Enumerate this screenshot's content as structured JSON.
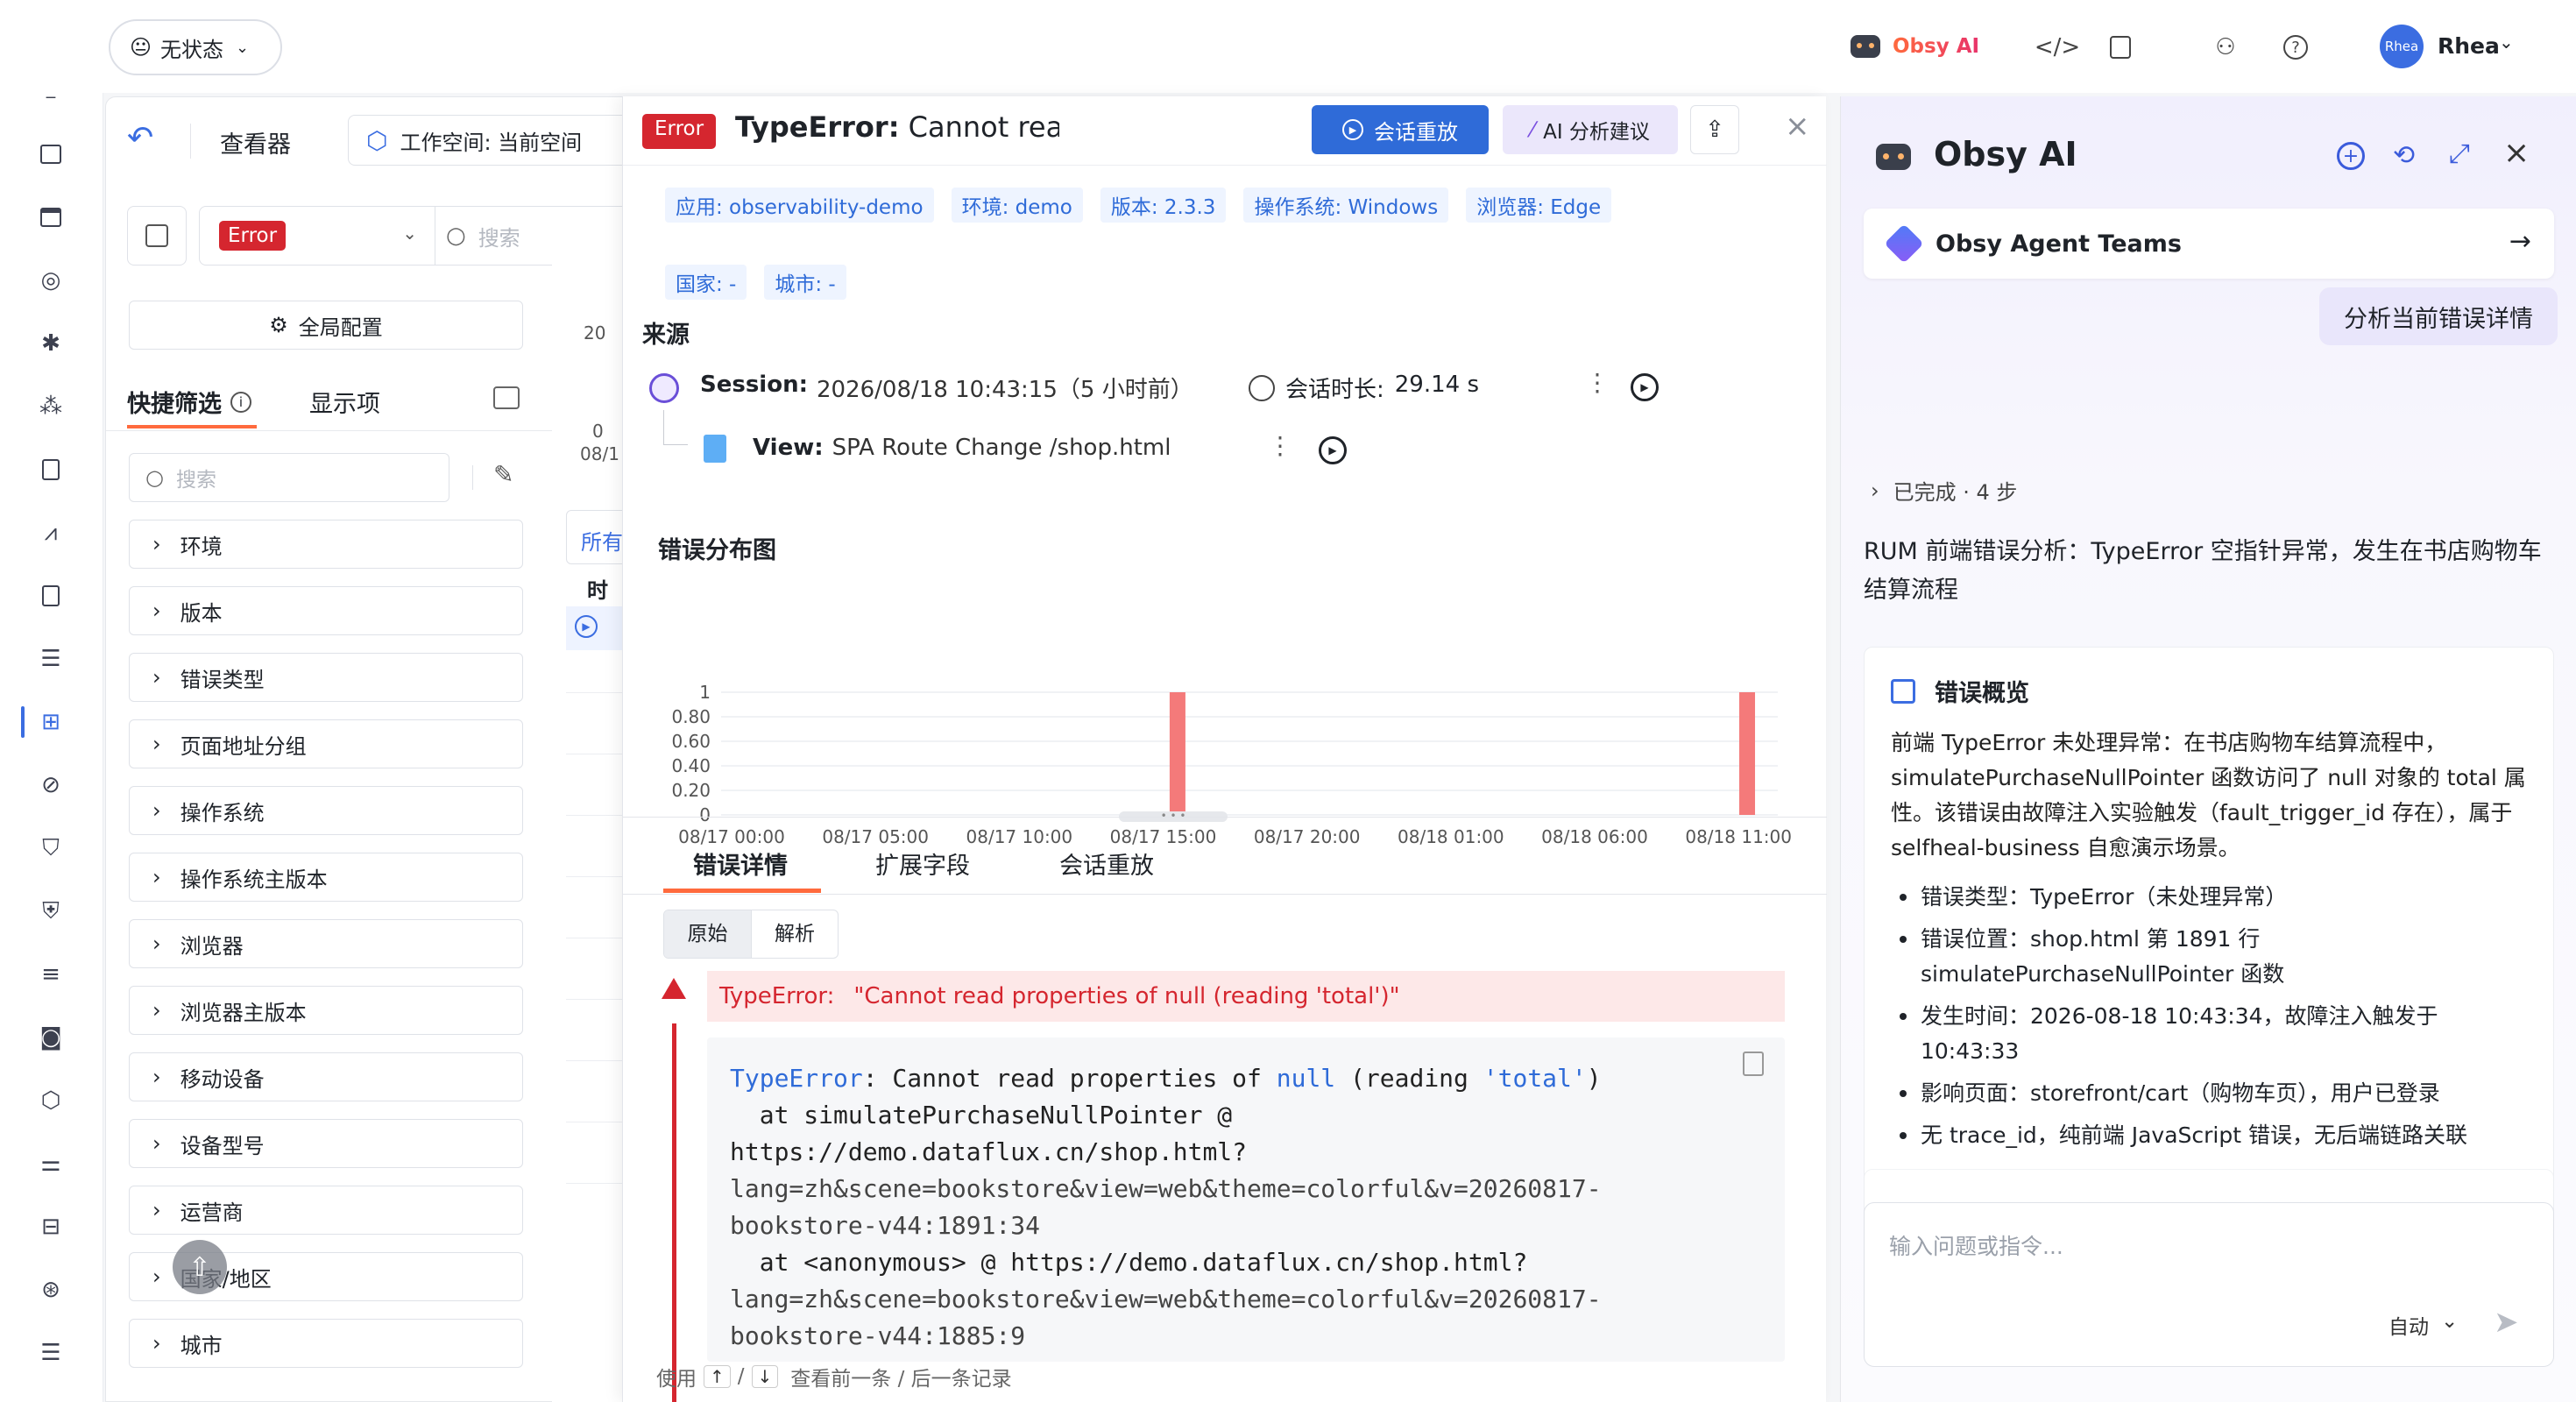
{
  "topbar": {
    "status_label": "无状态",
    "status_emoji": "😐",
    "ai_label": "Obsy AI",
    "user_name": "Rhea",
    "avatar_text": "Rhea"
  },
  "filter_panel": {
    "back_icon": "undo-icon",
    "viewer_label": "查看器",
    "workspace_label": "工作空间: 当前空间",
    "error_filter_value": "Error",
    "search_placeholder": "搜索",
    "global_config_label": "全局配置",
    "tab_quick_filter": "快捷筛选",
    "tab_display": "显示项",
    "facet_search_placeholder": "搜索",
    "facets": [
      "环境",
      "版本",
      "错误类型",
      "页面地址分组",
      "操作系统",
      "操作系统主版本",
      "浏览器",
      "浏览器主版本",
      "移动设备",
      "设备型号",
      "运营商",
      "国家/地区",
      "城市"
    ]
  },
  "mid_strip": {
    "y_top": "20",
    "y_zero": "0",
    "x_label": "08/1",
    "tab_all": "所有",
    "col_time": "时间"
  },
  "drawer": {
    "level_badge": "Error",
    "title_prefix": "TypeError:",
    "title_message": "Cannot read properties of null...",
    "replay_button": "会话重放",
    "ai_button": "AI 分析建议",
    "tags_row1": [
      "应用: observability-demo",
      "环境: demo",
      "版本: 2.3.3",
      "操作系统: Windows",
      "浏览器: Edge"
    ],
    "tags_row2": [
      "国家: -",
      "城市: -"
    ],
    "source_heading": "来源",
    "session_label": "Session:",
    "session_time": "2026/08/18 10:43:15（5 小时前）",
    "duration_label": "会话时长:",
    "duration_value": "29.14 s",
    "view_label": "View:",
    "view_value": "SPA Route Change /shop.html",
    "chart_title": "错误分布图",
    "tabs": [
      "错误详情",
      "扩展字段",
      "会话重放"
    ],
    "subtabs": [
      "原始",
      "解析"
    ],
    "error_banner_type": "TypeError:",
    "error_banner_msg": "\"Cannot read properties of null (reading 'total')\"",
    "stack_lines": [
      "TypeError: Cannot read properties of null (reading 'total')",
      "  at simulatePurchaseNullPointer @",
      "https://demo.dataflux.cn/shop.html?",
      "lang=zh&scene=bookstore&view=web&theme=colorful&v=20260817-",
      "bookstore-v44:1891:34",
      "  at <anonymous> @ https://demo.dataflux.cn/shop.html?",
      "lang=zh&scene=bookstore&view=web&theme=colorful&v=20260817-",
      "bookstore-v44:1885:9"
    ],
    "footer_use": "使用",
    "footer_up": "↑",
    "footer_sep": "/",
    "footer_down": "↓",
    "footer_text": "查看前一条 / 后一条记录"
  },
  "chart_data": {
    "type": "bar",
    "title": "错误分布图",
    "x_ticks": [
      "08/17 00:00",
      "08/17 05:00",
      "08/17 10:00",
      "08/17 15:00",
      "08/17 20:00",
      "08/18 01:00",
      "08/18 06:00",
      "08/18 11:00"
    ],
    "y_ticks": [
      "1",
      "0.80",
      "0.60",
      "0.40",
      "0.20",
      "0"
    ],
    "ylim": [
      0,
      1
    ],
    "x_range_hours": [
      0,
      36
    ],
    "bars": [
      {
        "x": "08/17 15:00",
        "x_hours": 15.5,
        "value": 1
      },
      {
        "x": "08/18 11:00",
        "x_hours": 35.3,
        "value": 1
      }
    ],
    "bar_color": "#f47a7a"
  },
  "ai_panel": {
    "title": "Obsy AI",
    "agent_teams": "Obsy Agent Teams",
    "user_message": "分析当前错误详情",
    "steps_label": "已完成 · 4 步",
    "summary": "RUM 前端错误分析：TypeError 空指针异常，发生在书店购物车结算流程",
    "overview_heading": "错误概览",
    "overview_text": "前端 TypeError 未处理异常：在书店购物车结算流程中，simulatePurchaseNullPointer 函数访问了 null 对象的 total 属性。该错误由故障注入实验触发（fault_trigger_id 存在），属于 selfheal-business 自愈演示场景。",
    "bullets": [
      "错误类型：TypeError（未处理异常）",
      "错误位置：shop.html 第 1891 行 simulatePurchaseNullPointer 函数",
      "发生时间：2026-08-18 10:43:34，故障注入触发于 10:43:33",
      "影响页面：storefront/cart（购物车页），用户已登录",
      "无 trace_id，纯前端 JavaScript 错误，无后端链路关联"
    ],
    "input_placeholder": "输入问题或指令...",
    "mode_label": "自动"
  }
}
